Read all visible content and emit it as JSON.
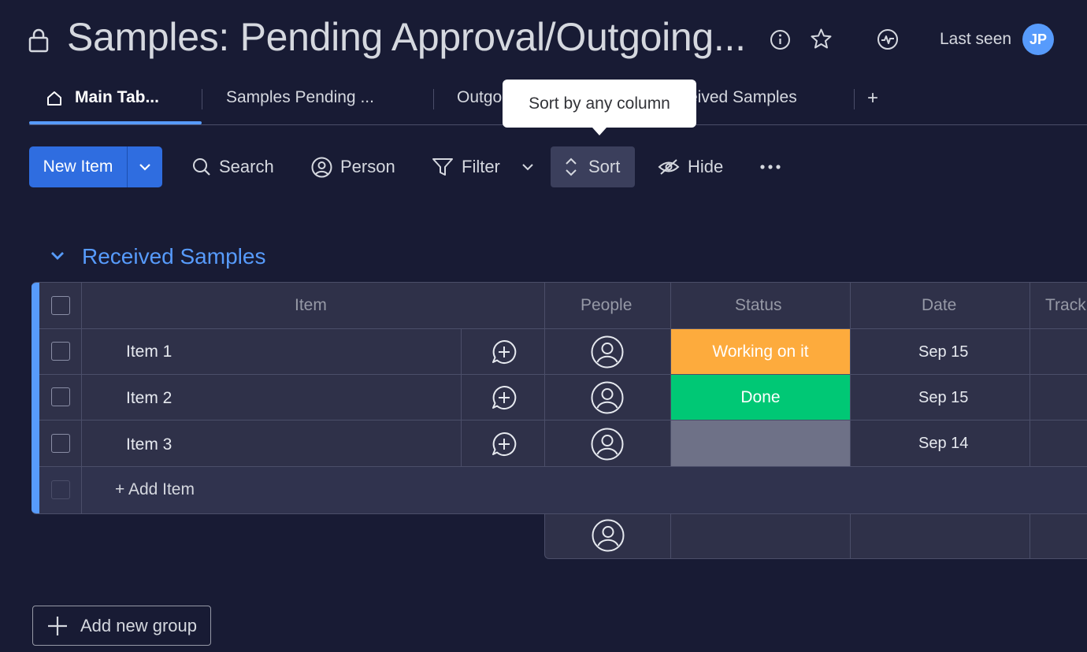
{
  "header": {
    "title": "Samples: Pending Approval/Outgoing...",
    "last_seen_label": "Last seen",
    "avatar_initials": "JP"
  },
  "tabs": [
    {
      "label": "Main Tab...",
      "active": true
    },
    {
      "label": "Samples Pending ..."
    },
    {
      "label": "Outgo"
    },
    {
      "label": "eived Samples"
    },
    {
      "label": "+"
    }
  ],
  "tooltip": {
    "text": "Sort by any column"
  },
  "toolbar": {
    "new_item_label": "New Item",
    "search_label": "Search",
    "person_label": "Person",
    "filter_label": "Filter",
    "sort_label": "Sort",
    "hide_label": "Hide"
  },
  "group": {
    "title": "Received Samples",
    "color": "#579bfc",
    "columns": [
      "Item",
      "People",
      "Status",
      "Date",
      "Track"
    ],
    "rows": [
      {
        "item": "Item 1",
        "status": "Working on it",
        "status_color": "#fdab3d",
        "date": "Sep 15"
      },
      {
        "item": "Item 2",
        "status": "Done",
        "status_color": "#00c875",
        "date": "Sep 15"
      },
      {
        "item": "Item 3",
        "status": "",
        "status_color": "#797e93",
        "date": "Sep 14"
      }
    ],
    "add_item_label": "+ Add Item"
  },
  "add_group_label": "Add new group"
}
